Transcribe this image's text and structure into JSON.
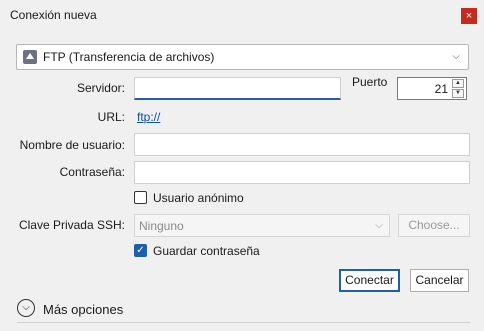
{
  "window": {
    "title": "Conexión nueva",
    "close_glyph": "×"
  },
  "protocol": {
    "icon": "ftp-protocol-icon",
    "selected": "FTP (Transferencia de archivos)"
  },
  "form": {
    "server_label": "Servidor:",
    "server_value": "",
    "port_label": "Puerto",
    "port_value": "21",
    "url_label": "URL:",
    "url_value": "ftp://",
    "username_label": "Nombre de usuario:",
    "username_value": "",
    "password_label": "Contraseña:",
    "password_value": "",
    "anonymous_label": "Usuario anónimo",
    "anonymous_checked": false,
    "ssh_key_label": "Clave Privada SSH:",
    "ssh_key_value": "Ninguno",
    "choose_label": "Choose...",
    "save_password_label": "Guardar contraseña",
    "save_password_checked": true
  },
  "actions": {
    "connect_label": "Conectar",
    "cancel_label": "Cancelar"
  },
  "more": {
    "label": "Más opciones"
  },
  "colors": {
    "accent": "#1f5fa8",
    "link": "#0b4fa8",
    "close_red": "#c42b1c",
    "background": "#f0f0f0"
  }
}
